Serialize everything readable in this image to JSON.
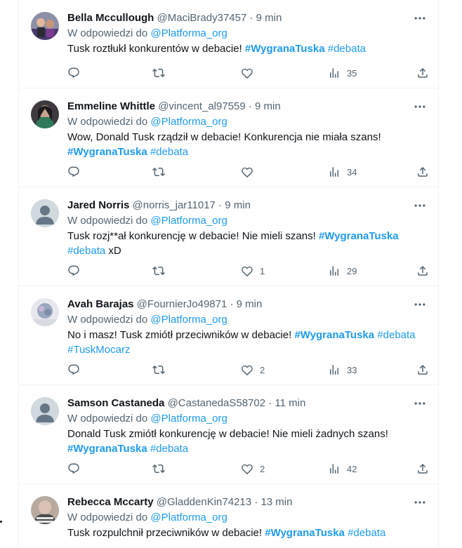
{
  "colors": {
    "link": "#1d9bf0",
    "muted": "#536471",
    "text": "#0f1419",
    "border": "#eff3f4"
  },
  "icons": {
    "more": "more-horizontal-icon",
    "reply": "reply-icon",
    "retweet": "retweet-icon",
    "like": "heart-icon",
    "views": "views-chart-icon",
    "share": "share-icon"
  },
  "tweets": [
    {
      "name": "Bella Mccullough",
      "handle": "@MaciBrady37457",
      "sep": "·",
      "time": "9 min",
      "reply_prefix": "W odpowiedzi do",
      "reply_to": "@Platforma_org",
      "line1": "Tusk roztłukł konkurentów w debacie!",
      "t1": "#WygranaTuska",
      "t2": "#debata",
      "likes": "",
      "views": "35"
    },
    {
      "name": "Emmeline Whittle",
      "handle": "@vincent_al97559",
      "sep": "·",
      "time": "9 min",
      "reply_prefix": "W odpowiedzi do",
      "reply_to": "@Platforma_org",
      "line1": "Wow, Donald Tusk rządził w debacie! Konkurencja nie miała szans!",
      "t1": "#WygranaTuska",
      "t2": "#debata",
      "likes": "",
      "views": "34"
    },
    {
      "name": "Jared Norris",
      "handle": "@norris_jar11017",
      "sep": "·",
      "time": "9 min",
      "reply_prefix": "W odpowiedzi do",
      "reply_to": "@Platforma_org",
      "line1": "Tusk rozj**ał konkurencję w debacie! Nie mieli szans!",
      "t1": "#WygranaTuska",
      "t2": "#debata",
      "tail": "xD",
      "likes": "1",
      "views": "29"
    },
    {
      "name": "Avah Barajas",
      "handle": "@FournierJo49871",
      "sep": "·",
      "time": "9 min",
      "reply_prefix": "W odpowiedzi do",
      "reply_to": "@Platforma_org",
      "line1": "No i masz! Tusk zmiótł przeciwników w debacie!",
      "t1": "#WygranaTuska",
      "t2": "#debata",
      "t3": "#TuskMocarz",
      "likes": "2",
      "views": "33"
    },
    {
      "name": "Samson Castaneda",
      "handle": "@CastanedaS58702",
      "sep": "·",
      "time": "11 min",
      "reply_prefix": "W odpowiedzi do",
      "reply_to": "@Platforma_org",
      "line1": "Donald Tusk zmiótł konkurencję w debacie! Nie mieli żadnych szans!",
      "t1": "#WygranaTuska",
      "t2": "#debata",
      "likes": "2",
      "views": "42"
    },
    {
      "name": "Rebecca Mccarty",
      "handle": "@GladdenKin74213",
      "sep": "·",
      "time": "13 min",
      "reply_prefix": "W odpowiedzi do",
      "reply_to": "@Platforma_org",
      "line1": "Tusk rozpulchnił przeciwników w debacie!",
      "t1": "#WygranaTuska",
      "t2": "#debata"
    }
  ]
}
